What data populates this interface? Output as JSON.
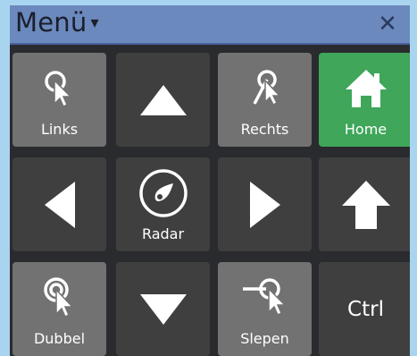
{
  "window": {
    "title": "Menü",
    "title_caret": "▾",
    "close_glyph": "✕"
  },
  "colors": {
    "titlebar": "#6b89bd",
    "panel": "#2a2b2e",
    "button_light": "#727272",
    "button_dark": "#3f3f3f",
    "home_green": "#3fa65a",
    "background": "#a9d4ef"
  },
  "buttons": [
    {
      "name": "links-button",
      "label": "Links",
      "icon": "left-click-icon"
    },
    {
      "name": "up-arrow-button",
      "label": "",
      "icon": "triangle-up-icon"
    },
    {
      "name": "rechts-button",
      "label": "Rechts",
      "icon": "right-click-icon"
    },
    {
      "name": "home-button",
      "label": "Home",
      "icon": "home-icon"
    },
    {
      "name": "left-arrow-button",
      "label": "",
      "icon": "triangle-left-icon"
    },
    {
      "name": "radar-button",
      "label": "Radar",
      "icon": "radar-icon"
    },
    {
      "name": "right-arrow-button",
      "label": "",
      "icon": "triangle-right-icon"
    },
    {
      "name": "scroll-up-button",
      "label": "",
      "icon": "arrow-up-icon"
    },
    {
      "name": "dubbel-button",
      "label": "Dubbel",
      "icon": "double-click-icon"
    },
    {
      "name": "down-arrow-button",
      "label": "",
      "icon": "triangle-down-icon"
    },
    {
      "name": "slepen-button",
      "label": "Slepen",
      "icon": "drag-icon"
    },
    {
      "name": "ctrl-button",
      "label": "Ctrl",
      "icon": ""
    }
  ]
}
